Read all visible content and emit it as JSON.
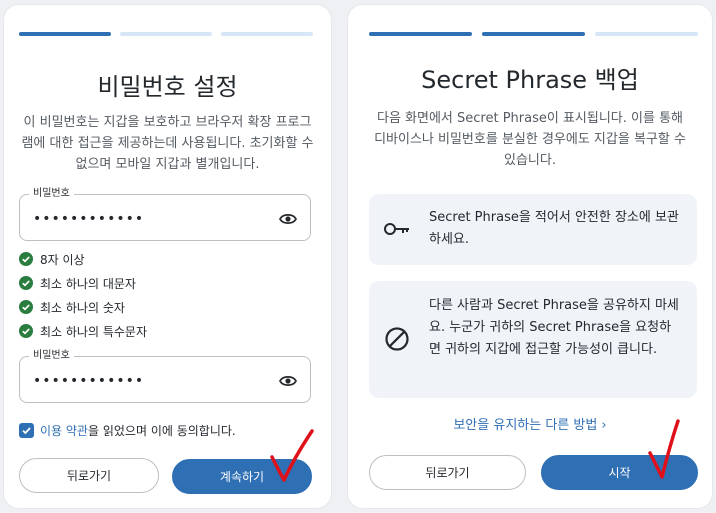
{
  "left": {
    "title": "비밀번호 설정",
    "description": "이 비밀번호는 지갑을 보호하고 브라우저 확장 프로그램에 대한 접근을 제공하는데 사용됩니다. 초기화할 수 없으며 모바일 지갑과 별개입니다.",
    "password_field": {
      "label": "비밀번호",
      "value": "••••••••••••"
    },
    "confirm_field": {
      "label": "비밀번호",
      "value": "••••••••••••"
    },
    "requirements": [
      "8자 이상",
      "최소 하나의 대문자",
      "최소 하나의 숫자",
      "최소 하나의 특수문자"
    ],
    "terms": {
      "checked": true,
      "link_text": "이용 약관",
      "text": "을 읽었으며 이에 동의합니다."
    },
    "back_label": "뒤로가기",
    "continue_label": "계속하기"
  },
  "right": {
    "title": "Secret Phrase 백업",
    "description": "다음 화면에서 Secret Phrase이 표시됩니다. 이를 통해 디바이스나 비밀번호를 분실한 경우에도 지갑을 복구할 수 있습니다.",
    "cards": [
      {
        "icon": "key-icon",
        "text": "Secret Phrase을 적어서 안전한 장소에 보관하세요."
      },
      {
        "icon": "prohibited-icon",
        "text": "다른 사람과 Secret Phrase을 공유하지 마세요. 누군가 귀하의 Secret Phrase을 요청하면 귀하의 지갑에 접근할 가능성이 큽니다."
      }
    ],
    "more_link": "보안을 유지하는 다른 방법 ›",
    "back_label": "뒤로가기",
    "start_label": "시작"
  },
  "colors": {
    "accent": "#2f6fb4",
    "success": "#2a7d3f",
    "annotation": "#e0101a"
  }
}
